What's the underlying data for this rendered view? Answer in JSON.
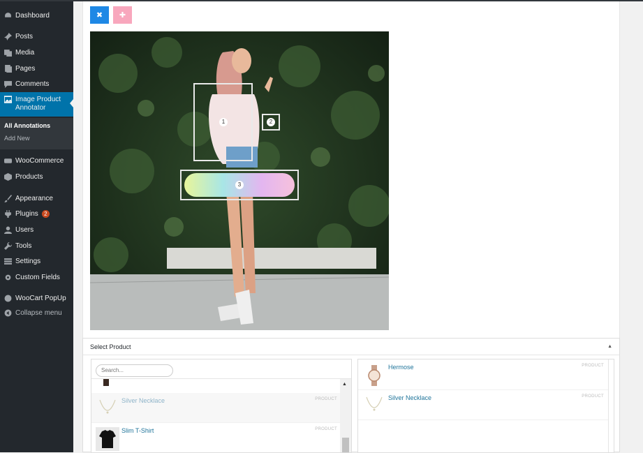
{
  "sidebar": {
    "items": [
      {
        "label": "Dashboard",
        "icon": "dashboard-icon"
      },
      {
        "label": "Posts",
        "icon": "pin-icon"
      },
      {
        "label": "Media",
        "icon": "media-icon"
      },
      {
        "label": "Pages",
        "icon": "pages-icon"
      },
      {
        "label": "Comments",
        "icon": "comment-icon"
      },
      {
        "label": "Image Product Annotator",
        "icon": "image-icon"
      },
      {
        "label": "WooCommerce",
        "icon": "woocommerce-icon"
      },
      {
        "label": "Products",
        "icon": "box-icon"
      },
      {
        "label": "Appearance",
        "icon": "brush-icon"
      },
      {
        "label": "Plugins",
        "icon": "plug-icon",
        "badge": "2"
      },
      {
        "label": "Users",
        "icon": "user-icon"
      },
      {
        "label": "Tools",
        "icon": "wrench-icon"
      },
      {
        "label": "Settings",
        "icon": "settings-icon"
      },
      {
        "label": "Custom Fields",
        "icon": "gear-icon"
      },
      {
        "label": "WooCart PopUp",
        "icon": "circle-icon"
      },
      {
        "label": "Collapse menu",
        "icon": "collapse-icon"
      }
    ],
    "submenu": [
      "All Annotations",
      "Add New"
    ]
  },
  "toolbar": {
    "close_label": "✖",
    "add_label": "✚"
  },
  "hotspots": [
    "1",
    "2",
    "3"
  ],
  "select_product": {
    "title": "Select Product",
    "search_placeholder": "Search...",
    "available": [
      {
        "name": "Silver Necklace",
        "type": "PRODUCT"
      },
      {
        "name": "Slim T-Shirt",
        "type": "PRODUCT"
      }
    ],
    "selected": [
      {
        "name": "Hermose",
        "type": "PRODUCT"
      },
      {
        "name": "Silver Necklace",
        "type": "PRODUCT"
      }
    ]
  },
  "colors": {
    "accent": "#0073aa",
    "sidebar": "#23282d",
    "close_btn": "#1e88e5",
    "add_btn": "#f8a7bd",
    "link": "#21759b"
  }
}
